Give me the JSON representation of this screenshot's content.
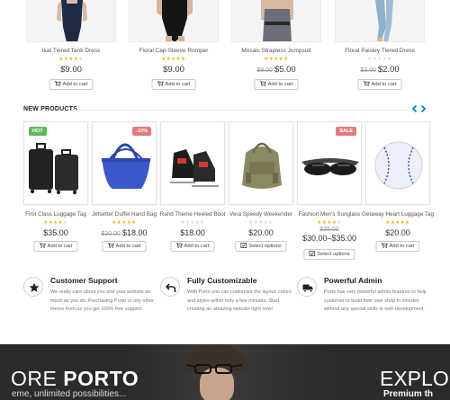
{
  "top_products": [
    {
      "name": "Ikat Tiered Tank Dress",
      "rating": 4,
      "price": "$9.00",
      "old_price": "",
      "button": "Add to cart"
    },
    {
      "name": "Floral Cap-Sleeve Romper",
      "rating": 5,
      "price": "$9.00",
      "old_price": "",
      "button": "Add to cart"
    },
    {
      "name": "Mosaic Strapless Jumpsuit",
      "rating": 5,
      "price": "$5.00",
      "old_price": "$9.00",
      "button": "Add to cart"
    },
    {
      "name": "Floral Paisley Tiered Dress",
      "rating": 0,
      "price": "$2.00",
      "old_price": "$3.00",
      "button": "Add to cart"
    }
  ],
  "new_products": {
    "title": "NEW PRODUCTS",
    "items": [
      {
        "name": "First Class Luggage Tag",
        "badge": "HOT",
        "badge_type": "hot",
        "rating": 4,
        "price": "$35.00",
        "old_price": "",
        "button": "Add to cart",
        "icon": "cart-icon"
      },
      {
        "name": "Jetsetter Duffel Hand Bag",
        "badge": "-10%",
        "badge_type": "sale",
        "rating": 5,
        "price": "$18.00",
        "old_price": "$20.00",
        "button": "Add to cart",
        "icon": "cart-icon"
      },
      {
        "name": "Rand Theme Heeled Boot",
        "badge": "",
        "badge_type": "",
        "rating": 0,
        "price": "$18.00",
        "old_price": "",
        "button": "Add to cart",
        "icon": "cart-icon"
      },
      {
        "name": "Vera Speedy Weekender",
        "badge": "",
        "badge_type": "",
        "rating": 0,
        "price": "$20.00",
        "old_price": "",
        "button": "Select options",
        "icon": "options-icon"
      },
      {
        "name": "Fashion Men's Sunglass",
        "badge": "SALE",
        "badge_type": "sale",
        "rating": 4,
        "price": "$30.00–$35.00",
        "old_price": "$35.00",
        "button": "Select options",
        "icon": "options-icon"
      },
      {
        "name": "Getaway Heart Luggage Tag",
        "badge": "",
        "badge_type": "",
        "rating": 5,
        "price": "$20.00",
        "old_price": "",
        "button": "Add to cart",
        "icon": "cart-icon"
      }
    ]
  },
  "features": [
    {
      "icon": "star-icon",
      "title": "Customer Support",
      "text": "We really care about you and your website as much as you do. Purchasing Porto or any other theme from us you get 100% free support."
    },
    {
      "icon": "undo-arrow-icon",
      "title": "Fully Customizable",
      "text": "With Porto you can customize the layout, colors and styles within only a few minutes. Start creating an amazing website right now!"
    },
    {
      "icon": "truck-icon",
      "title": "Powerful Admin",
      "text": "Porto has very powerful admin features to help customer to build their own shop in minutes without any special skills in web development."
    }
  ],
  "hero": {
    "left_title_light": "ORE ",
    "left_title_bold": "PORTO",
    "left_subtitle": "eme, unlimited possibilities...",
    "right_title": "EXPLO",
    "right_subtitle": "Premium th"
  },
  "colors": {
    "star": "#f2b515",
    "hot_badge": "#62b959",
    "sale_badge": "#e27c7c",
    "nav_arrow": "#0088cc",
    "hero_bg": "#2b2b2b"
  }
}
